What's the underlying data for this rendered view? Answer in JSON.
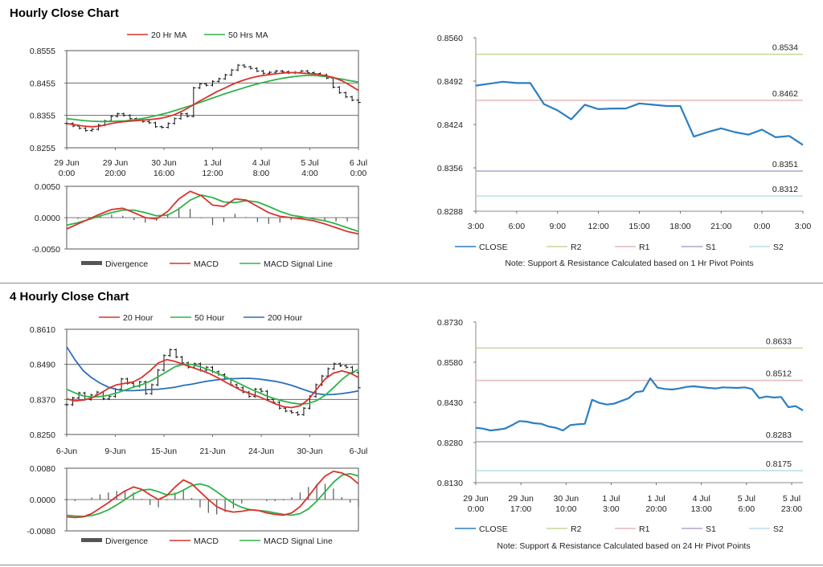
{
  "sections": {
    "hourly_title": "Hourly Close Chart",
    "four_hourly_title": "4 Hourly Close Chart"
  },
  "colors": {
    "ma20": "#d9322c",
    "ma50": "#2fb34a",
    "ma200": "#2a6fba",
    "close": "#2b7fc3",
    "r2": "#c3d69b",
    "r1": "#e6b9b8",
    "s1": "#b3a2c7",
    "s2": "#b7dee8",
    "divergence": "#555555",
    "price": "#111111"
  },
  "chart_data": [
    {
      "id": "hourly_price",
      "type": "line",
      "legend": [
        "20 Hr MA",
        "50 Hrs MA"
      ],
      "y_ticks": [
        "0.8555",
        "0.8455",
        "0.8355",
        "0.8255"
      ],
      "ylim": [
        0.8255,
        0.8555
      ],
      "x_ticks": [
        [
          "29 Jun",
          "0:00"
        ],
        [
          "29 Jun",
          "20:00"
        ],
        [
          "30 Jun",
          "16:00"
        ],
        [
          "1 Jul",
          "12:00"
        ],
        [
          "4 Jul",
          "8:00"
        ],
        [
          "5 Jul",
          "4:00"
        ],
        [
          "6 Jul",
          "0:00"
        ]
      ],
      "price_close": [
        0.833,
        0.8322,
        0.8315,
        0.8308,
        0.8312,
        0.8325,
        0.8338,
        0.8352,
        0.836,
        0.8355,
        0.8345,
        0.834,
        0.8336,
        0.8332,
        0.832,
        0.8318,
        0.833,
        0.8345,
        0.836,
        0.8352,
        0.844,
        0.8452,
        0.8448,
        0.846,
        0.8468,
        0.848,
        0.8495,
        0.851,
        0.8505,
        0.85,
        0.8492,
        0.8485,
        0.8488,
        0.8492,
        0.849,
        0.8486,
        0.8488,
        0.8492,
        0.8487,
        0.8484,
        0.848,
        0.847,
        0.8442,
        0.8425,
        0.8412,
        0.8402,
        0.8395
      ],
      "ma20": [
        0.833,
        0.8326,
        0.8322,
        0.832,
        0.8322,
        0.8328,
        0.8333,
        0.8336,
        0.8338,
        0.834,
        0.8342,
        0.8345,
        0.835,
        0.8358,
        0.837,
        0.8385,
        0.84,
        0.8414,
        0.8428,
        0.844,
        0.8452,
        0.8462,
        0.847,
        0.8476,
        0.848,
        0.8483,
        0.8486,
        0.8487,
        0.8486,
        0.8484,
        0.8482,
        0.8478,
        0.8472,
        0.8462,
        0.8448,
        0.8432
      ],
      "ma50": [
        0.8345,
        0.8342,
        0.8339,
        0.8337,
        0.8336,
        0.8336,
        0.8337,
        0.8338,
        0.8341,
        0.8345,
        0.835,
        0.8356,
        0.8362,
        0.837,
        0.8378,
        0.8386,
        0.8395,
        0.8404,
        0.8413,
        0.8422,
        0.843,
        0.8438,
        0.8446,
        0.8453,
        0.8459,
        0.8465,
        0.847,
        0.8474,
        0.8477,
        0.8479,
        0.8478,
        0.8475,
        0.8471,
        0.8467,
        0.8462,
        0.8458
      ]
    },
    {
      "id": "hourly_macd",
      "type": "line",
      "legend": [
        "Divergence",
        "MACD",
        "MACD  Signal Line"
      ],
      "y_ticks": [
        "0.0050",
        "0.0000",
        "-0.0050"
      ],
      "ylim": [
        -0.005,
        0.005
      ],
      "macd": [
        -0.0018,
        -0.001,
        -0.0002,
        0.0006,
        0.0013,
        0.0015,
        0.0008,
        0.0,
        -0.0002,
        0.001,
        0.003,
        0.0042,
        0.0035,
        0.002,
        0.0018,
        0.003,
        0.0028,
        0.0018,
        0.0008,
        0.0002,
        0.0,
        -0.0002,
        -0.0005,
        -0.001,
        -0.0016,
        -0.0022,
        -0.0026
      ],
      "signal": [
        -0.0012,
        -0.0008,
        -0.0003,
        0.0003,
        0.0008,
        0.0012,
        0.0012,
        0.0008,
        0.0003,
        0.0004,
        0.0014,
        0.0028,
        0.0036,
        0.0032,
        0.0025,
        0.0024,
        0.0027,
        0.0025,
        0.0018,
        0.001,
        0.0004,
        0.0001,
        -0.0002,
        -0.0005,
        -0.001,
        -0.0016,
        -0.0022
      ],
      "divergence": [
        -0.0006,
        -0.0002,
        0.0001,
        0.0003,
        0.0005,
        0.0003,
        -0.0004,
        -0.0008,
        -0.0005,
        0.0006,
        0.0016,
        0.0014,
        -0.0001,
        -0.0012,
        -0.0007,
        0.0006,
        0.0001,
        -0.0007,
        -0.001,
        -0.0008,
        -0.0004,
        -0.0003,
        -0.0003,
        -0.0005,
        -0.0006,
        -0.0006,
        -0.0004
      ]
    },
    {
      "id": "hourly_close",
      "type": "line",
      "y_ticks": [
        "0.8560",
        "0.8492",
        "0.8424",
        "0.8356",
        "0.8288"
      ],
      "ylim": [
        0.8288,
        0.856
      ],
      "x_ticks": [
        "3:00",
        "6:00",
        "9:00",
        "12:00",
        "15:00",
        "18:00",
        "21:00",
        "0:00",
        "3:00"
      ],
      "close": [
        0.8485,
        0.8488,
        0.8491,
        0.8489,
        0.8489,
        0.8456,
        0.8446,
        0.8432,
        0.8455,
        0.8448,
        0.8449,
        0.8449,
        0.8457,
        0.8455,
        0.8453,
        0.8453,
        0.8405,
        0.8412,
        0.8418,
        0.8412,
        0.8408,
        0.8416,
        0.8404,
        0.8406,
        0.8392
      ],
      "levels": [
        {
          "key": "r2",
          "value": 0.8534,
          "label": "0.8534"
        },
        {
          "key": "r1",
          "value": 0.8462,
          "label": "0.8462"
        },
        {
          "key": "s1",
          "value": 0.8351,
          "label": "0.8351"
        },
        {
          "key": "s2",
          "value": 0.8312,
          "label": "0.8312"
        }
      ],
      "legend": [
        "CLOSE",
        "R2",
        "R1",
        "S1",
        "S2"
      ],
      "note": "Note: Support & Resistance Calculated based on 1 Hr Pivot Points"
    },
    {
      "id": "four_hourly_price",
      "type": "line",
      "legend": [
        "20 Hour",
        "50 Hour",
        "200 Hour"
      ],
      "y_ticks": [
        "0.8610",
        "0.8490",
        "0.8370",
        "0.8250"
      ],
      "ylim": [
        0.825,
        0.861
      ],
      "x_ticks": [
        "6-Jun",
        "9-Jun",
        "15-Jun",
        "21-Jun",
        "24-Jun",
        "30-Jun",
        "6-Jul"
      ],
      "price_close": [
        0.8352,
        0.8375,
        0.8392,
        0.837,
        0.8385,
        0.8395,
        0.8372,
        0.838,
        0.8405,
        0.844,
        0.8425,
        0.8415,
        0.843,
        0.839,
        0.842,
        0.847,
        0.852,
        0.854,
        0.8515,
        0.8495,
        0.848,
        0.8492,
        0.847,
        0.848,
        0.8465,
        0.8455,
        0.844,
        0.842,
        0.841,
        0.8395,
        0.838,
        0.8405,
        0.8398,
        0.837,
        0.836,
        0.834,
        0.833,
        0.8325,
        0.8318,
        0.834,
        0.838,
        0.842,
        0.845,
        0.8475,
        0.8492,
        0.8485,
        0.848,
        0.8462,
        0.841
      ],
      "ma20": [
        0.8372,
        0.8365,
        0.8368,
        0.8375,
        0.839,
        0.8408,
        0.842,
        0.8425,
        0.843,
        0.8445,
        0.8468,
        0.8495,
        0.8506,
        0.85,
        0.849,
        0.848,
        0.847,
        0.846,
        0.8446,
        0.843,
        0.8415,
        0.84,
        0.839,
        0.838,
        0.8368,
        0.8355,
        0.8345,
        0.8342,
        0.8348,
        0.837,
        0.8405,
        0.844,
        0.846,
        0.8468,
        0.846,
        0.8445
      ],
      "ma50": [
        0.8405,
        0.8392,
        0.8382,
        0.8378,
        0.838,
        0.8384,
        0.8392,
        0.8402,
        0.8412,
        0.842,
        0.8432,
        0.8448,
        0.8465,
        0.8482,
        0.849,
        0.849,
        0.8482,
        0.8472,
        0.846,
        0.8448,
        0.8434,
        0.842,
        0.8406,
        0.8394,
        0.8382,
        0.8372,
        0.8364,
        0.8358,
        0.8354,
        0.8356,
        0.8366,
        0.8384,
        0.841,
        0.8438,
        0.846,
        0.8472
      ],
      "ma200": [
        0.855,
        0.8505,
        0.8468,
        0.8444,
        0.8426,
        0.8412,
        0.8404,
        0.84,
        0.84,
        0.8402,
        0.8404,
        0.8405,
        0.8408,
        0.8412,
        0.8418,
        0.8422,
        0.8428,
        0.8433,
        0.8437,
        0.844,
        0.8441,
        0.8442,
        0.8442,
        0.844,
        0.8436,
        0.8432,
        0.8426,
        0.8418,
        0.8408,
        0.8398,
        0.839,
        0.8386,
        0.8387,
        0.839,
        0.8394,
        0.8399
      ]
    },
    {
      "id": "four_hourly_macd",
      "type": "line",
      "legend": [
        "Divergence",
        "MACD",
        "MACD  Signal Line"
      ],
      "y_ticks": [
        "0.0080",
        "0.0000",
        "-0.0080"
      ],
      "ylim": [
        -0.008,
        0.008
      ],
      "macd": [
        -0.0044,
        -0.0046,
        -0.0044,
        -0.0036,
        -0.0022,
        -0.0008,
        0.0008,
        0.0022,
        0.0032,
        0.0026,
        0.0012,
        0.0,
        0.001,
        0.0032,
        0.005,
        0.004,
        0.002,
        0.0,
        -0.0018,
        -0.0028,
        -0.0032,
        -0.003,
        -0.0026,
        -0.0028,
        -0.0034,
        -0.0038,
        -0.004,
        -0.0034,
        -0.0018,
        0.0008,
        0.0036,
        0.006,
        0.0072,
        0.0068,
        0.0058,
        0.004
      ],
      "signal": [
        -0.004,
        -0.0042,
        -0.0043,
        -0.0041,
        -0.0035,
        -0.0026,
        -0.0014,
        0.0,
        0.0014,
        0.0024,
        0.0026,
        0.002,
        0.0012,
        0.0014,
        0.0024,
        0.0036,
        0.004,
        0.0034,
        0.002,
        0.0004,
        -0.001,
        -0.002,
        -0.0026,
        -0.0028,
        -0.003,
        -0.0034,
        -0.0038,
        -0.004,
        -0.0036,
        -0.0024,
        -0.0004,
        0.002,
        0.0044,
        0.0062,
        0.0066,
        0.006
      ],
      "divergence": [
        -0.0004,
        -0.0004,
        -0.0001,
        0.0005,
        0.0013,
        0.0018,
        0.0022,
        0.0022,
        0.0018,
        0.0002,
        -0.0014,
        -0.002,
        -0.0002,
        0.0018,
        0.0026,
        0.0004,
        -0.002,
        -0.0034,
        -0.0038,
        -0.0032,
        -0.0022,
        -0.001,
        0.0,
        0.0,
        -0.0004,
        -0.0004,
        -0.0002,
        0.0006,
        0.0018,
        0.0032,
        0.004,
        0.004,
        0.0028,
        0.0006,
        -0.0008,
        -0.002
      ]
    },
    {
      "id": "four_hourly_close",
      "type": "line",
      "y_ticks": [
        "0.8730",
        "0.8580",
        "0.8430",
        "0.8280",
        "0.8130"
      ],
      "ylim": [
        0.813,
        0.873
      ],
      "x_ticks": [
        [
          "29 Jun",
          "0:00"
        ],
        [
          "29 Jun",
          "17:00"
        ],
        [
          "30 Jun",
          "10:00"
        ],
        [
          "1 Jul",
          "3:00"
        ],
        [
          "1 Jul",
          "20:00"
        ],
        [
          "4 Jul",
          "13:00"
        ],
        [
          "5 Jul",
          "6:00"
        ],
        [
          "5 Jul",
          "23:00"
        ]
      ],
      "close": [
        0.8335,
        0.8332,
        0.8325,
        0.8328,
        0.8332,
        0.8345,
        0.836,
        0.8358,
        0.8352,
        0.835,
        0.834,
        0.8335,
        0.8325,
        0.8345,
        0.8348,
        0.835,
        0.844,
        0.8428,
        0.8422,
        0.8425,
        0.8435,
        0.8445,
        0.8468,
        0.8472,
        0.852,
        0.8485,
        0.848,
        0.8478,
        0.8482,
        0.8488,
        0.849,
        0.8487,
        0.8484,
        0.8482,
        0.8486,
        0.8485,
        0.8484,
        0.8486,
        0.848,
        0.8446,
        0.8452,
        0.8448,
        0.845,
        0.8412,
        0.8416,
        0.84
      ],
      "levels": [
        {
          "key": "r2",
          "value": 0.8633,
          "label": "0.8633"
        },
        {
          "key": "r1",
          "value": 0.8512,
          "label": "0.8512"
        },
        {
          "key": "s1",
          "value": 0.8283,
          "label": "0.8283"
        },
        {
          "key": "s2",
          "value": 0.8175,
          "label": "0.8175"
        }
      ],
      "legend": [
        "CLOSE",
        "R2",
        "R1",
        "S1",
        "S2"
      ],
      "note": "Note: Support & Resistance Calculated based on 24 Hr Pivot Points"
    }
  ]
}
